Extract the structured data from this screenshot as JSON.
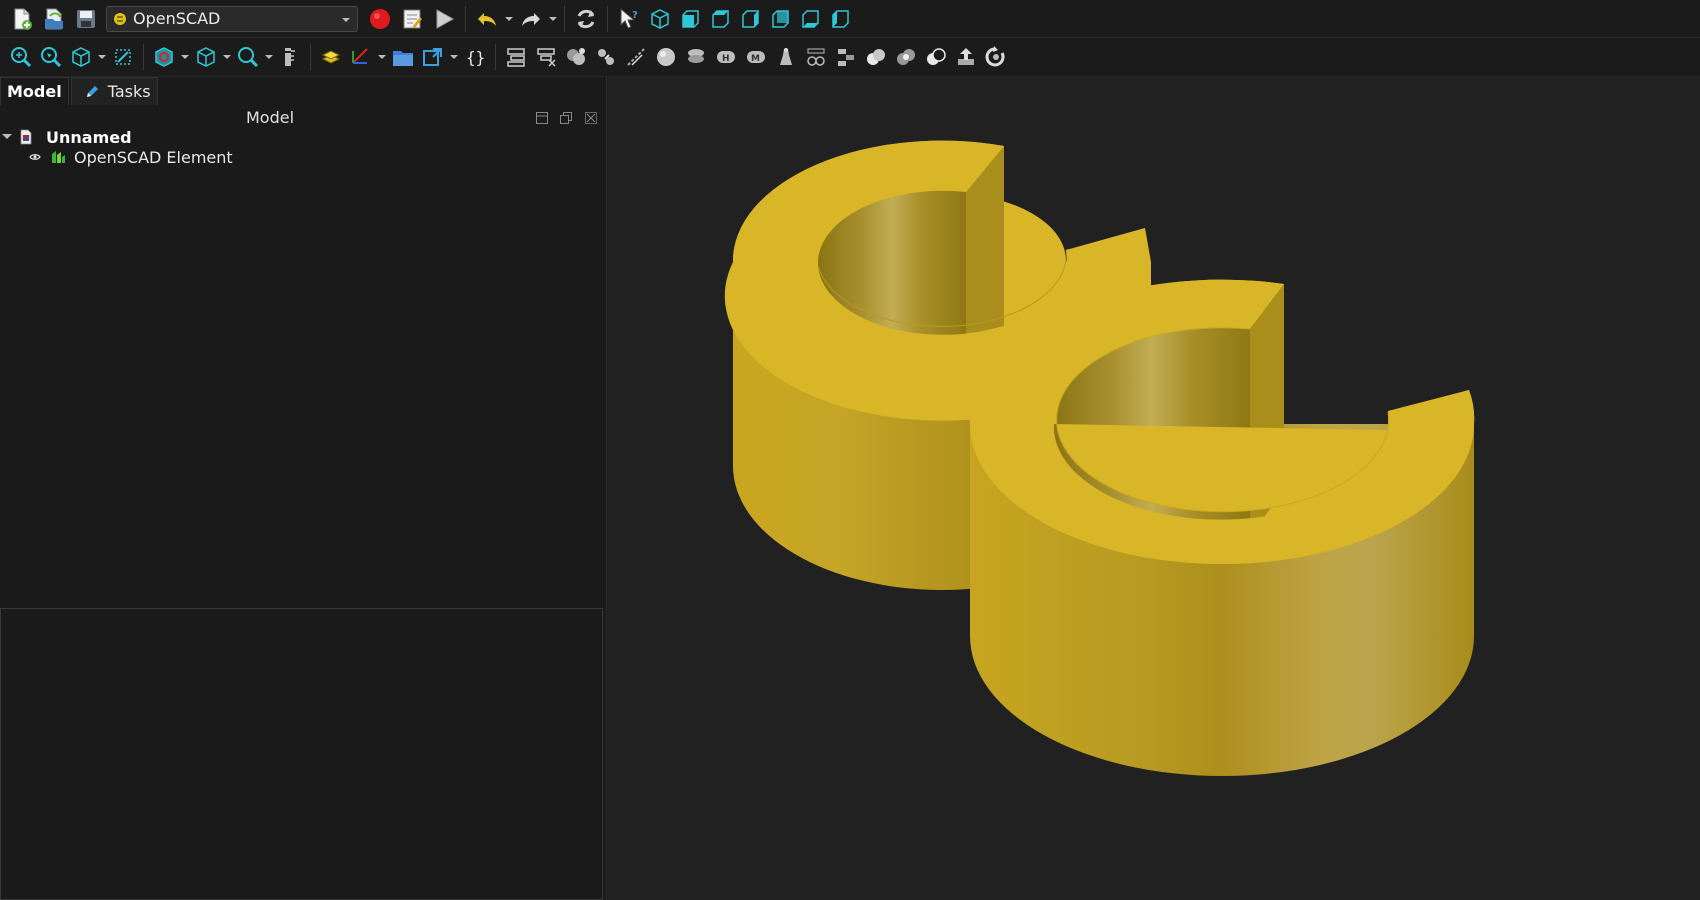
{
  "toolbar_top": {
    "workbench_selector": {
      "selected": "OpenSCAD",
      "icon": "openscad-workbench-icon"
    },
    "file_buttons": [
      "new-document-icon",
      "open-document-icon",
      "save-document-icon"
    ],
    "macro_buttons": [
      "macro-record-icon",
      "macro-edit-icon",
      "macro-run-icon"
    ],
    "edit_buttons": [
      "undo-icon",
      "redo-icon",
      "refresh-icon",
      "whats-this-icon"
    ],
    "view_buttons": [
      "view-isometric-icon",
      "view-front-icon",
      "view-top-icon",
      "view-right-icon",
      "view-rear-icon",
      "view-bottom-icon",
      "view-left-icon"
    ]
  },
  "toolbar_openscad": {
    "buttons": [
      "fit-all-icon",
      "fit-selection-icon",
      "draw-style-icon",
      "bounding-box-icon",
      "std-views-icon",
      "measure-icon",
      "part-icon",
      "axis-cross-icon",
      "group-icon",
      "link-icon",
      "add-openscad-element-icon",
      "color-codes-icon",
      "edge-to-face-icon",
      "refine-shape-icon",
      "expand-placements-icon",
      "explode-group-icon",
      "replace-object-icon",
      "add-sphere-icon",
      "mirror-mesh-icon",
      "hull-icon",
      "minkowski-icon",
      "primitive-icon",
      "import-csg-icon",
      "resize-icon",
      "increase-tolerance-icon",
      "union-icon",
      "intersection-icon",
      "difference-icon",
      "export-icon",
      "rotate-extrude-icon"
    ]
  },
  "panel": {
    "tabs": [
      {
        "label": "Model",
        "active": true
      },
      {
        "label": "Tasks",
        "active": false
      }
    ],
    "tree_title": "Model",
    "tree": {
      "document": {
        "label": "Unnamed",
        "expanded": true
      },
      "children": [
        {
          "label": "OpenSCAD Element",
          "icon": "openscad-element-icon"
        }
      ]
    }
  },
  "viewport": {
    "background": "#212121",
    "model_color": "#d9b526"
  }
}
